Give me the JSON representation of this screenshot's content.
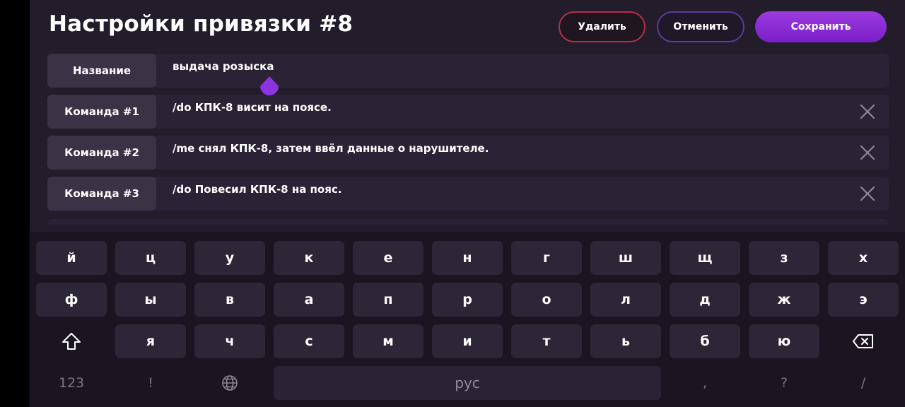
{
  "header": {
    "title": "Настройки привязки #8",
    "delete_label": "Удалить",
    "cancel_label": "Отменить",
    "save_label": "Сохранить"
  },
  "rows": [
    {
      "label": "Название",
      "value": "выдача розыска"
    },
    {
      "label": "Команда #1",
      "value": "/do КПК-8 висит на поясе."
    },
    {
      "label": "Команда #2",
      "value": "/me снял КПК-8, затем ввёл данные о нарушителе."
    },
    {
      "label": "Команда #3",
      "value": "/do Повесил КПК-8 на пояс."
    }
  ],
  "keyboard": {
    "row1": [
      "й",
      "ц",
      "у",
      "к",
      "е",
      "н",
      "г",
      "ш",
      "щ",
      "з",
      "х"
    ],
    "row2": [
      "ф",
      "ы",
      "в",
      "а",
      "п",
      "р",
      "о",
      "л",
      "д",
      "ж",
      "э"
    ],
    "row3": [
      "я",
      "ч",
      "с",
      "м",
      "и",
      "т",
      "ь",
      "б",
      "ю"
    ],
    "bottom": {
      "numbers": "123",
      "exclamation": "!",
      "space": "рус",
      "comma": ",",
      "question": "?",
      "slash": "/"
    },
    "icons": {
      "shift": "shift-icon",
      "backspace": "backspace-icon",
      "language": "globe-icon"
    }
  },
  "colors": {
    "background": "#221c2b",
    "accent": "#8a2be2",
    "delete_border": "#b6304a",
    "cancel_border": "#5e3a9c"
  }
}
